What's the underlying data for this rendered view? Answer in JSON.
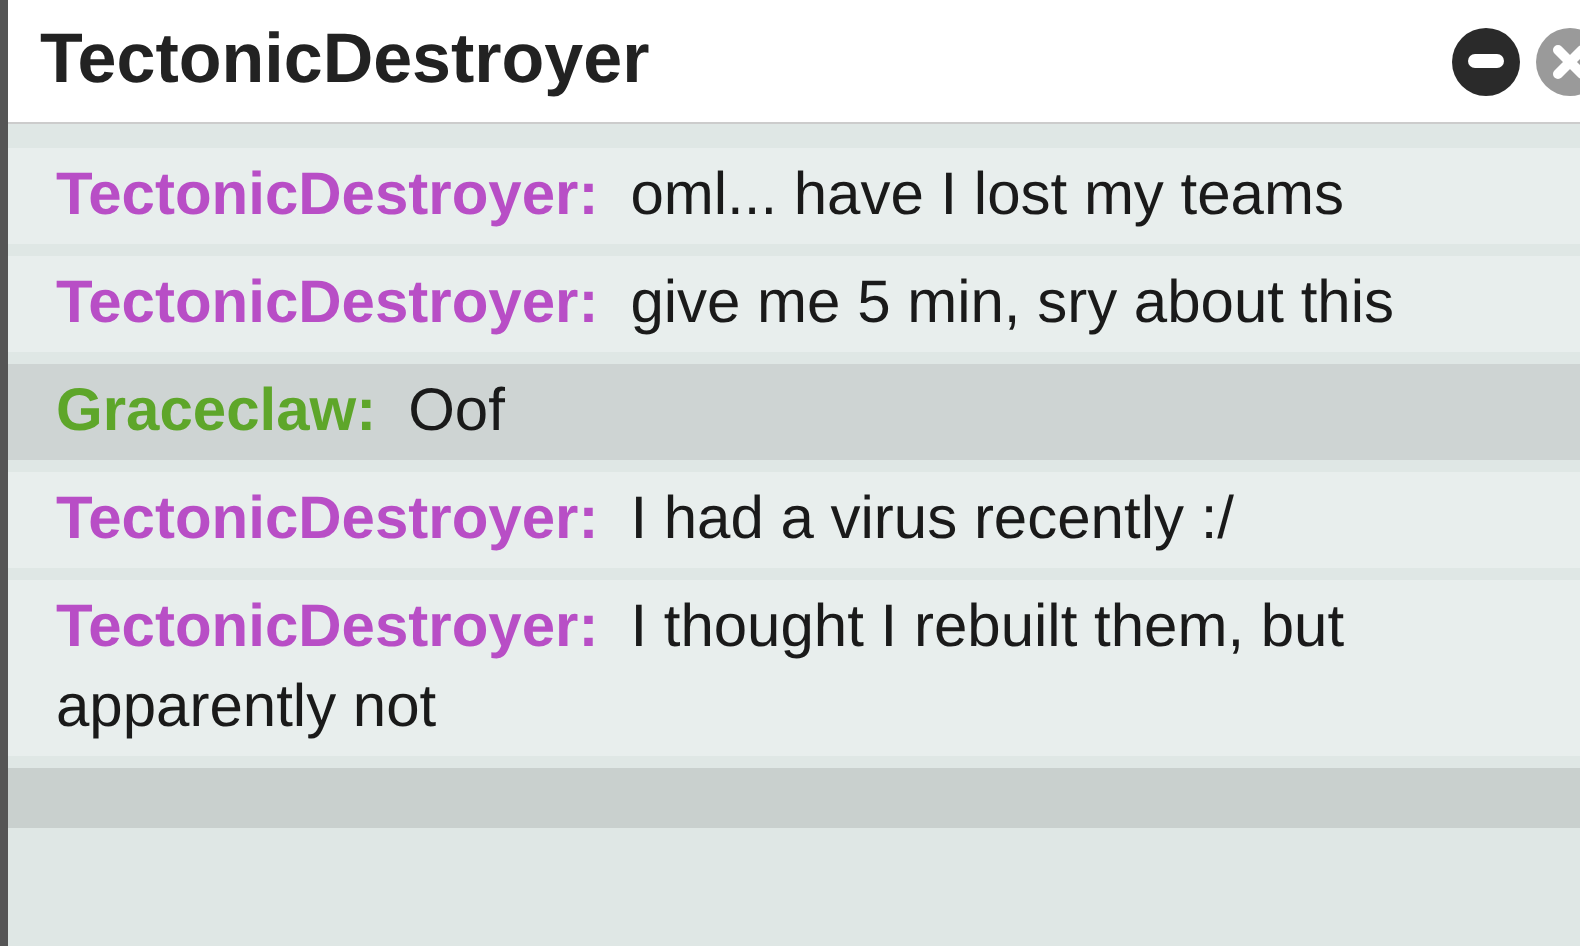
{
  "window": {
    "title": "TectonicDestroyer"
  },
  "messages": [
    {
      "author": "TectonicDestroyer:",
      "color": "#b84ec6",
      "text": "oml... have I lost my teams",
      "highlighted": false
    },
    {
      "author": "TectonicDestroyer:",
      "color": "#b84ec6",
      "text": "give me 5 min, sry about this",
      "highlighted": false
    },
    {
      "author": "Graceclaw:",
      "color": "#5ea62a",
      "text": "Oof",
      "highlighted": true
    },
    {
      "author": "TectonicDestroyer:",
      "color": "#b84ec6",
      "text": "I had a virus recently :/",
      "highlighted": false
    },
    {
      "author": "TectonicDestroyer:",
      "color": "#b84ec6",
      "text": "I thought I rebuilt them, but apparently not",
      "highlighted": false
    }
  ]
}
